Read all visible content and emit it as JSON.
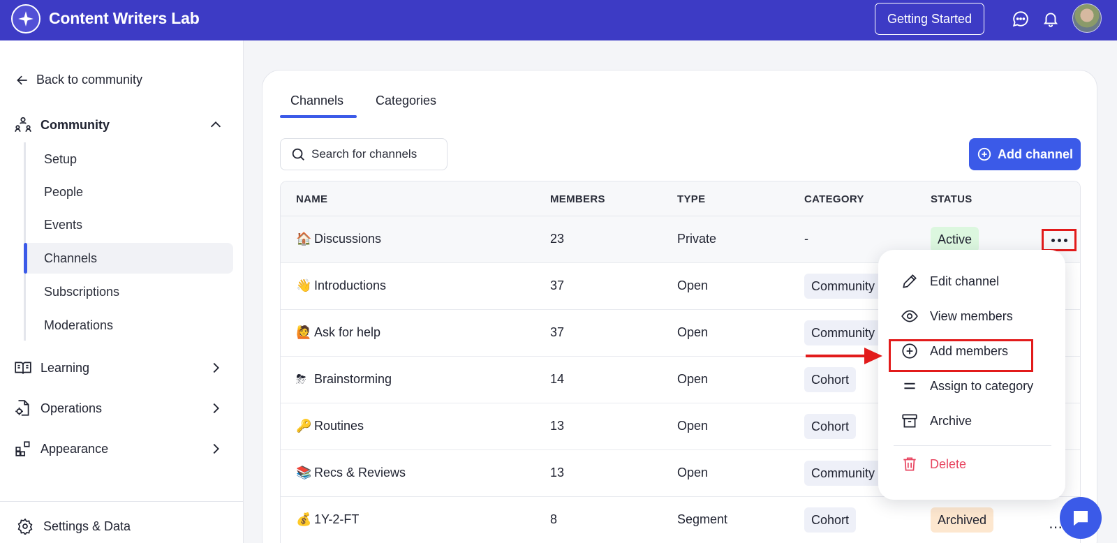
{
  "app": {
    "name": "Content Writers Lab",
    "getting_started": "Getting Started"
  },
  "sidebar": {
    "back": "Back to community",
    "community": {
      "label": "Community",
      "items": [
        "Setup",
        "People",
        "Events",
        "Channels",
        "Subscriptions",
        "Moderations"
      ],
      "active": "Channels"
    },
    "groups": [
      {
        "label": "Learning",
        "icon": "book-icon"
      },
      {
        "label": "Operations",
        "icon": "file-gear-icon"
      },
      {
        "label": "Appearance",
        "icon": "blocks-icon"
      }
    ],
    "settings": "Settings & Data"
  },
  "main": {
    "tabs": [
      "Channels",
      "Categories"
    ],
    "active_tab": "Channels",
    "search_placeholder": "Search for channels",
    "add_channel": "Add channel",
    "columns": [
      "NAME",
      "MEMBERS",
      "TYPE",
      "CATEGORY",
      "STATUS"
    ],
    "rows": [
      {
        "emoji": "🏠",
        "name": "Discussions",
        "members": "23",
        "type": "Private",
        "category": "-",
        "status": "Active"
      },
      {
        "emoji": "👋",
        "name": "Introductions",
        "members": "37",
        "type": "Open",
        "category": "Community",
        "status": ""
      },
      {
        "emoji": "🙋",
        "name": "Ask for help",
        "members": "37",
        "type": "Open",
        "category": "Community",
        "status": ""
      },
      {
        "emoji": "⛈",
        "name": "Brainstorming",
        "members": "14",
        "type": "Open",
        "category": "Cohort",
        "status": ""
      },
      {
        "emoji": "🔑",
        "name": "Routines",
        "members": "13",
        "type": "Open",
        "category": "Cohort",
        "status": ""
      },
      {
        "emoji": "📚",
        "name": "Recs & Reviews",
        "members": "13",
        "type": "Open",
        "category": "Community",
        "status": ""
      },
      {
        "emoji": "💰",
        "name": "1Y-2-FT",
        "members": "8",
        "type": "Segment",
        "category": "Cohort",
        "status": "Archived"
      }
    ]
  },
  "menu": {
    "items": [
      "Edit channel",
      "View members",
      "Add members",
      "Assign to category",
      "Archive"
    ],
    "delete": "Delete"
  },
  "colors": {
    "brand": "#3d3bc5",
    "accent": "#3b5ae8",
    "annotation": "#e21b1b",
    "delete": "#e84560"
  }
}
